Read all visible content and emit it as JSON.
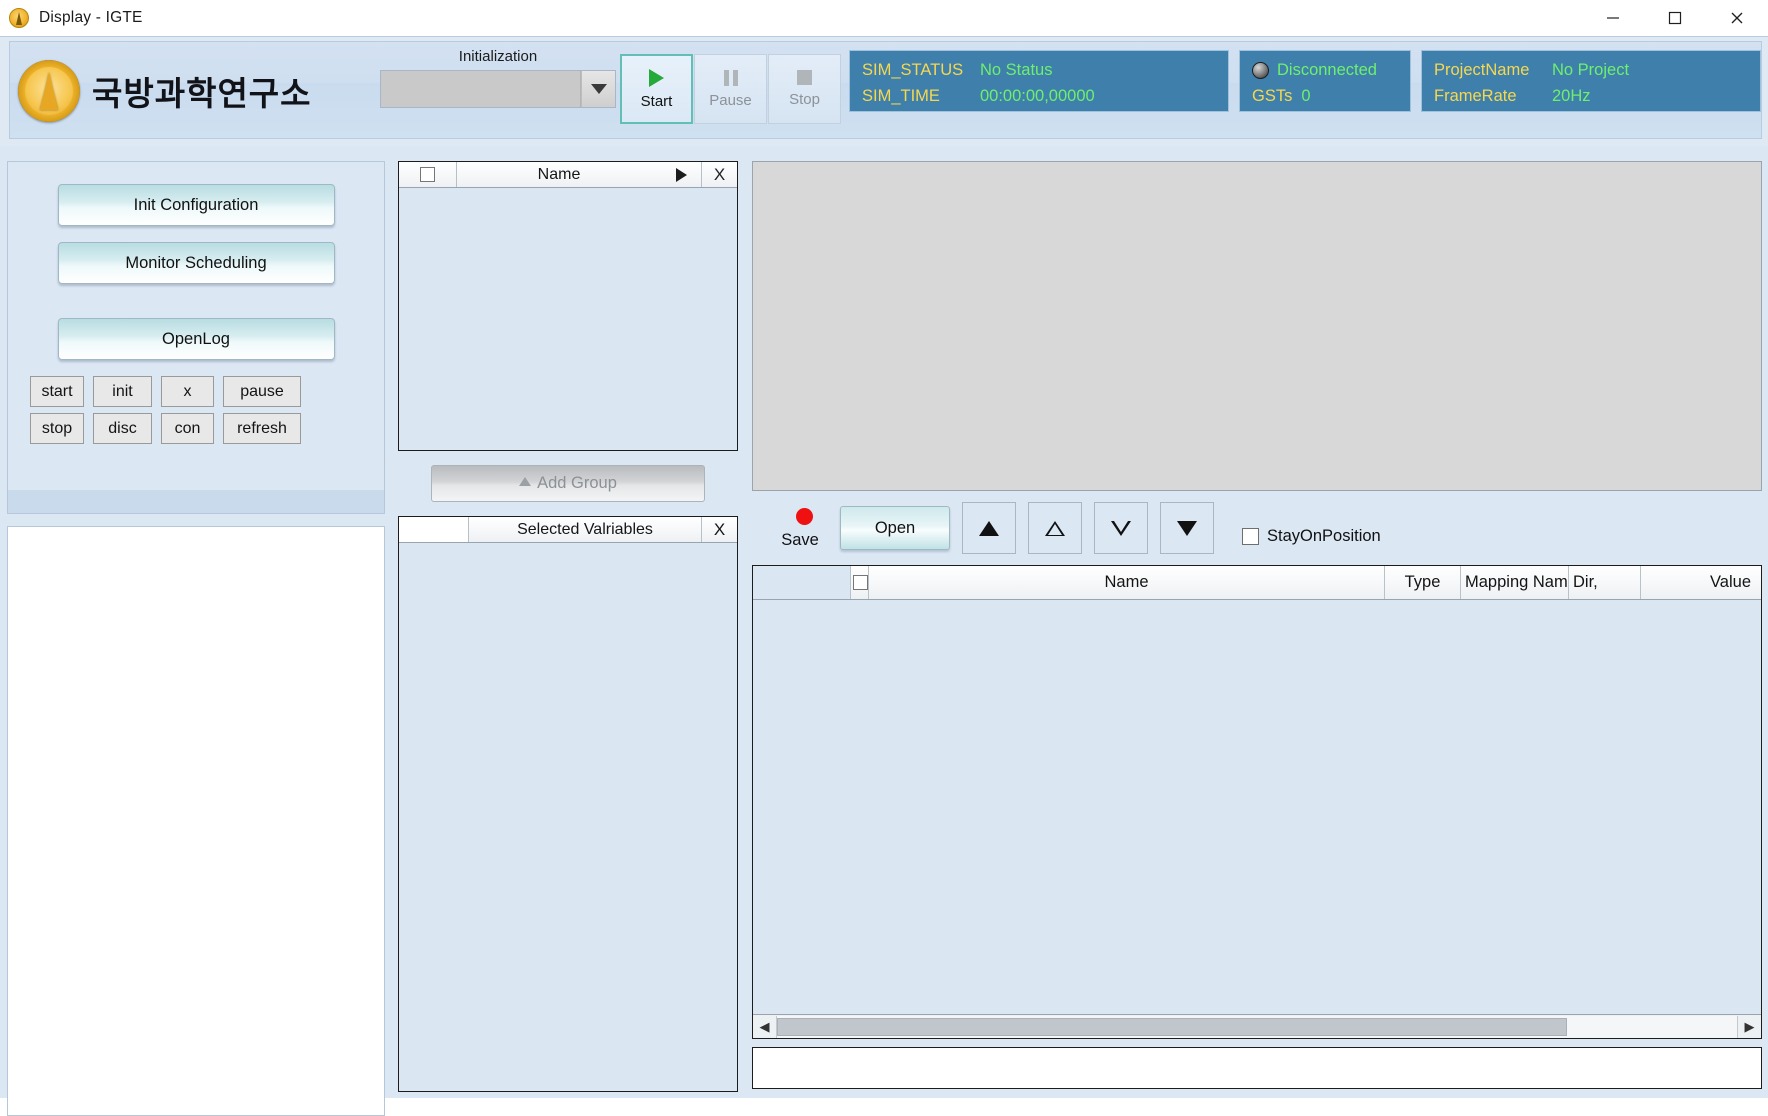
{
  "window": {
    "title": "Display - IGTE",
    "app_icon": "igte-logo-icon",
    "minimize": "minimize-icon",
    "maximize": "maximize-icon",
    "close": "close-icon"
  },
  "banner": {
    "org_name": "국방과학연구소",
    "init": {
      "label": "Initialization",
      "value": "",
      "placeholder": ""
    },
    "transport": [
      {
        "label": "Start",
        "icon": "play-icon",
        "enabled": true
      },
      {
        "label": "Pause",
        "icon": "pause-icon",
        "enabled": false
      },
      {
        "label": "Stop",
        "icon": "stop-icon",
        "enabled": false
      }
    ],
    "sim": {
      "status_key": "SIM_STATUS",
      "status_value": "No Status",
      "time_key": "SIM_TIME",
      "time_value": "00:00:00,00000"
    },
    "connection": {
      "state": "Disconnected",
      "gsts_key": "GSTs",
      "gsts_value": "0",
      "led": "status-led-icon"
    },
    "project": {
      "name_key": "ProjectName",
      "name_value": "No Project",
      "rate_key": "FrameRate",
      "rate_value": "20Hz"
    },
    "colors": {
      "panel_bg": "#3f7fac",
      "key_text": "#f5d84f",
      "value_text": "#6df06d",
      "banner_bg": "#cfdff0"
    }
  },
  "left_panel": {
    "buttons": [
      {
        "label": "Init Configuration"
      },
      {
        "label": "Monitor Scheduling"
      },
      {
        "label": "OpenLog"
      }
    ],
    "mini_buttons_row1": [
      {
        "label": "start"
      },
      {
        "label": "init"
      },
      {
        "label": "x"
      },
      {
        "label": "pause"
      }
    ],
    "mini_buttons_row2": [
      {
        "label": "stop"
      },
      {
        "label": "disc"
      },
      {
        "label": "con"
      },
      {
        "label": "refresh"
      }
    ]
  },
  "name_panel": {
    "title": "Name",
    "select_all": "",
    "expand_icon": "play-right-icon",
    "close_label": "X",
    "rows": []
  },
  "add_group": {
    "label": "Add Group",
    "icon": "triangle-up-icon",
    "enabled": false
  },
  "selected_panel": {
    "title": "Selected Valriables",
    "close_label": "X",
    "rows": []
  },
  "right_toolbar": {
    "save_label": "Save",
    "save_icon": "record-dot-icon",
    "open_label": "Open",
    "move_buttons": [
      {
        "icon": "arrow-up-filled-icon",
        "name": "move-top-button"
      },
      {
        "icon": "arrow-up-outline-icon",
        "name": "move-up-button"
      },
      {
        "icon": "arrow-down-outline-icon",
        "name": "move-down-button"
      },
      {
        "icon": "arrow-down-filled-icon",
        "name": "move-bottom-button"
      }
    ],
    "stay_on_position": {
      "label": "StayOnPosition",
      "checked": false
    }
  },
  "variable_table": {
    "columns": [
      {
        "key": "index",
        "label": ""
      },
      {
        "key": "check",
        "label": ""
      },
      {
        "key": "name",
        "label": "Name"
      },
      {
        "key": "type",
        "label": "Type"
      },
      {
        "key": "mapping",
        "label": "Mapping Nam"
      },
      {
        "key": "dir",
        "label": "Dir,"
      },
      {
        "key": "value",
        "label": "Value"
      }
    ],
    "rows": [],
    "hscroll": {
      "left_arrow": "chevron-left-icon",
      "right_arrow": "chevron-right-icon"
    }
  }
}
